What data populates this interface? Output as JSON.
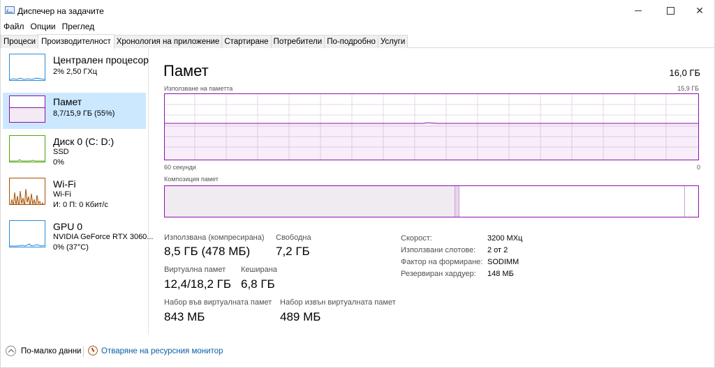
{
  "window": {
    "title": "Диспечер на задачите"
  },
  "menu": [
    "Файл",
    "Опции",
    "Преглед"
  ],
  "tabs": [
    "Процеси",
    "Производителност",
    "Хронология на приложение",
    "Стартиране",
    "Потребители",
    "По-подробно",
    "Услуги"
  ],
  "active_tab": "Производителност",
  "sidebar": [
    {
      "name": "Централен процесор",
      "line1": "2% 2,50 ГХц",
      "line2": ""
    },
    {
      "name": "Памет",
      "line1": "8,7/15,9 ГБ (55%)",
      "line2": ""
    },
    {
      "name": "Диск 0 (C: D:)",
      "line1": "SSD",
      "line2": "0%"
    },
    {
      "name": "Wi-Fi",
      "line1": "Wi-Fi",
      "line2": "И: 0 П: 0 Кбит/с"
    },
    {
      "name": "GPU 0",
      "line1": "NVIDIA GeForce RTX 3060...",
      "line2": "0% (37°C)"
    }
  ],
  "memory": {
    "title": "Памет",
    "total": "16,0 ГБ",
    "usage_label": "Използване на паметта",
    "usage_max": "15,9 ГБ",
    "usage_fraction": 0.55,
    "time_left": "60 секунди",
    "time_right": "0",
    "composition_label": "Композиция памет",
    "stats": {
      "in_use_label": "Използвана (компресирана)",
      "in_use_value": "8,5 ГБ (478 МБ)",
      "available_label": "Свободна",
      "available_value": "7,2 ГБ",
      "committed_label": "Виртуална памет",
      "committed_value": "12,4/18,2 ГБ",
      "cached_label": "Кеширана",
      "cached_value": "6,8 ГБ",
      "paged_label": "Набор във виртуалната памет",
      "paged_value": "843 МБ",
      "nonpaged_label": "Набор извън виртуалната памет",
      "nonpaged_value": "489 МБ"
    },
    "details": [
      {
        "label": "Скорост:",
        "value": "3200 МХц"
      },
      {
        "label": "Използвани слотове:",
        "value": "2 от 2"
      },
      {
        "label": "Фактор на формиране:",
        "value": "SODIMM"
      },
      {
        "label": "Резервиран хардуер:",
        "value": "148 МБ"
      }
    ]
  },
  "footer": {
    "less_details": "По-малко данни",
    "resource_monitor": "Отваряне на ресурсния монитор"
  },
  "colors": {
    "memory": "#8b12ae",
    "cpu": "#2a8bd9",
    "disk": "#4da60c",
    "wifi": "#a74f01",
    "selected": "#cce8ff"
  }
}
